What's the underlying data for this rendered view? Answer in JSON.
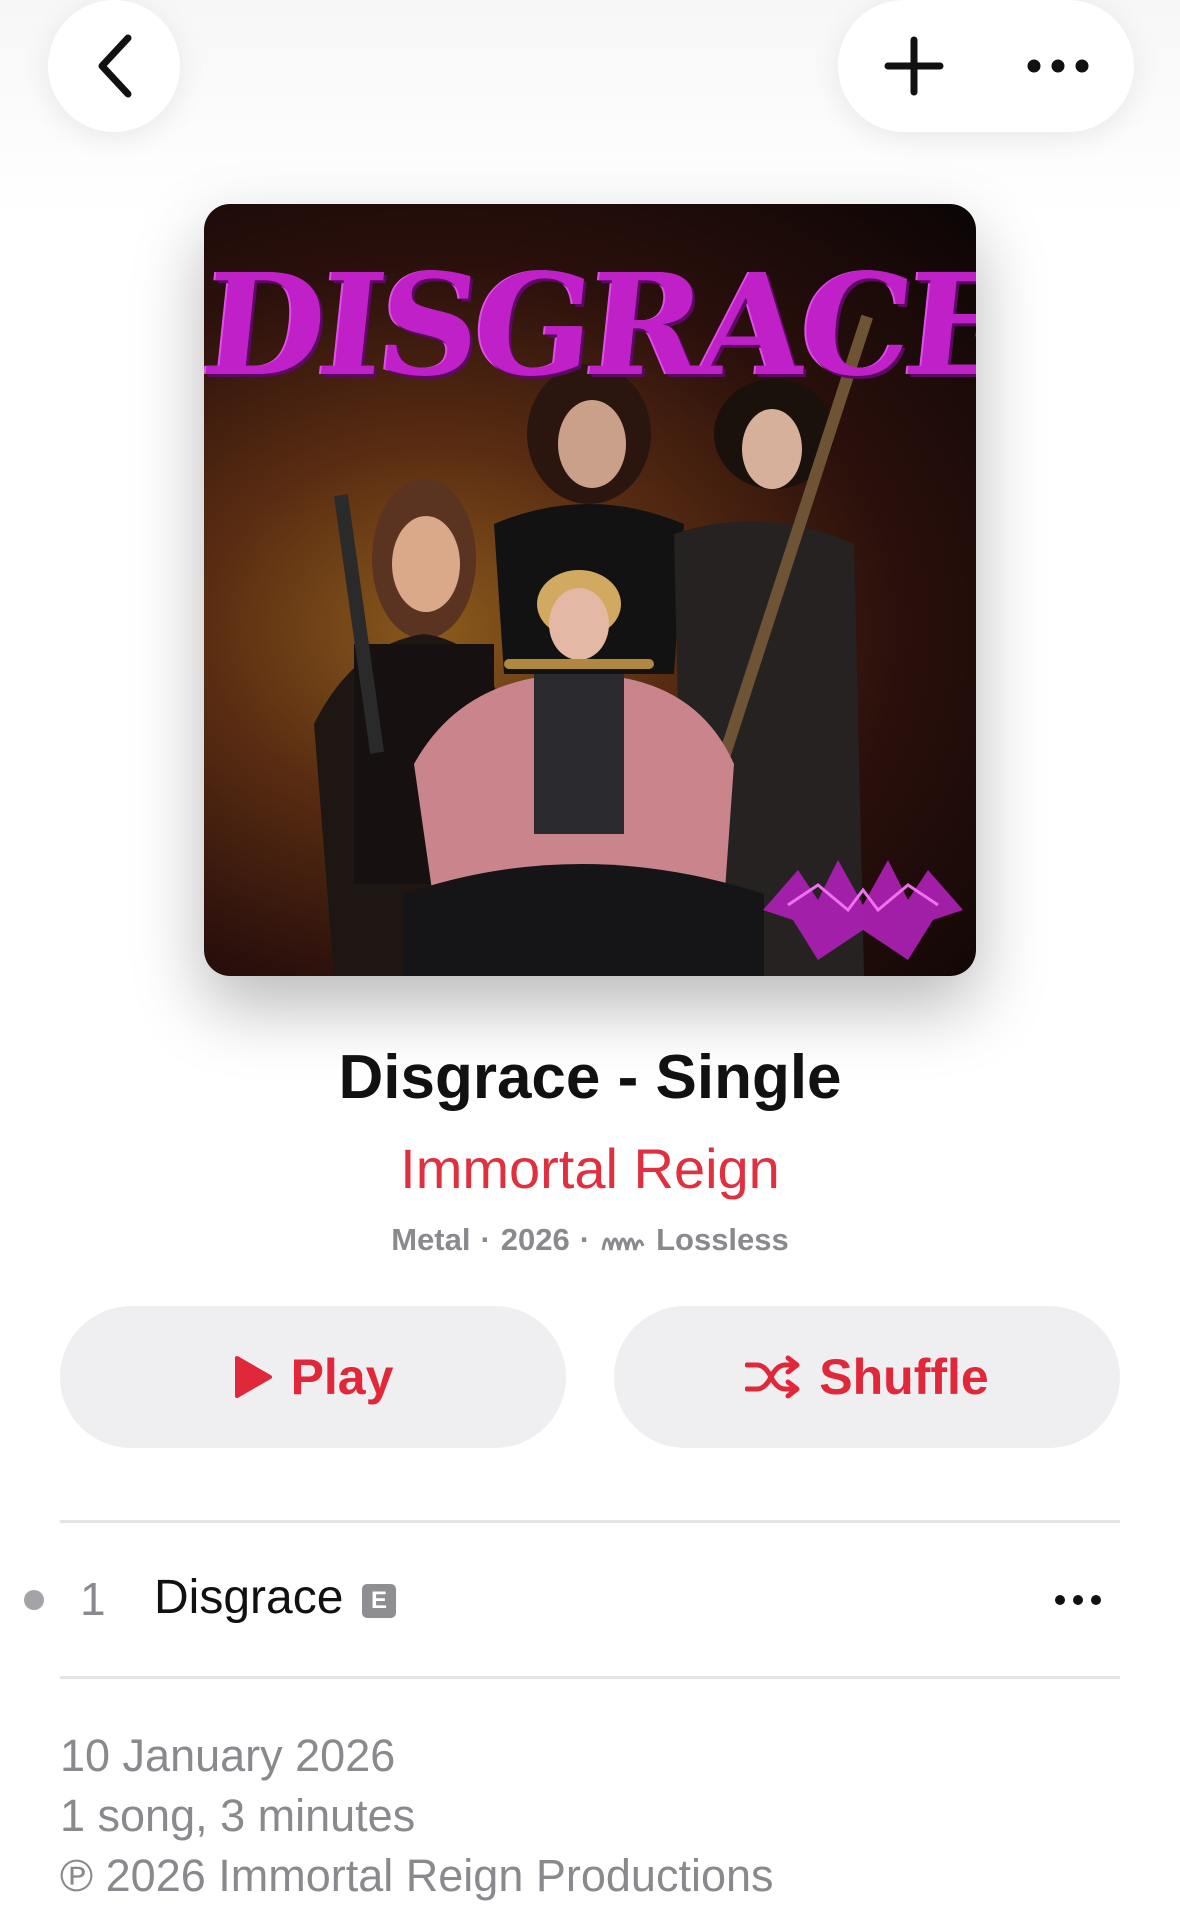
{
  "album": {
    "title": "Disgrace - Single",
    "artist": "Immortal Reign",
    "genre": "Metal",
    "separator": "·",
    "year": "2026",
    "quality": "Lossless",
    "artwork_text": "DISGRACE"
  },
  "buttons": {
    "play": "Play",
    "shuffle": "Shuffle"
  },
  "tracks": [
    {
      "number": "1",
      "title": "Disgrace",
      "explicit": "E"
    }
  ],
  "footer": {
    "release_date": "10 January 2026",
    "summary": "1 song, 3 minutes",
    "copyright": "℗ 2026 Immortal Reign Productions"
  },
  "icons": {
    "back": "chevron-left-icon",
    "add": "plus-icon",
    "more": "ellipsis-icon",
    "play": "play-icon",
    "shuffle": "shuffle-icon",
    "lossless": "lossless-icon"
  },
  "colors": {
    "accent": "#e0283a",
    "artist": "#e0303f",
    "secondary_text": "#8a8a8e",
    "button_bg": "#efeff1",
    "artwork_title": "#c020c8"
  }
}
